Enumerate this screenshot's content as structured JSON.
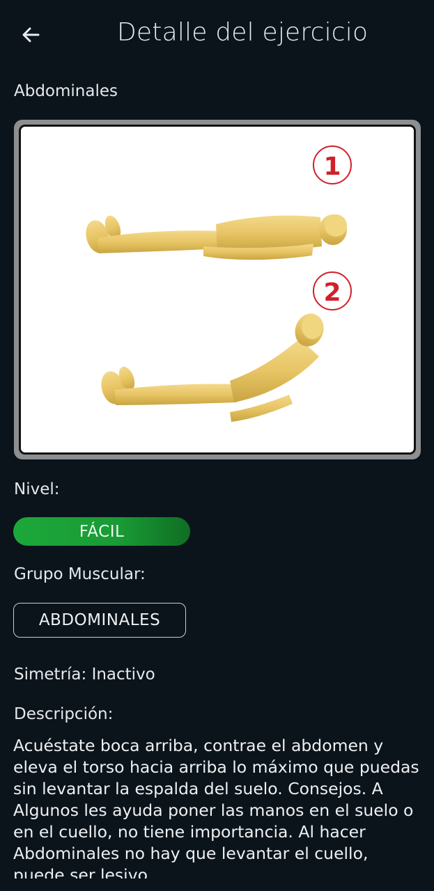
{
  "header": {
    "title": "Detalle del ejercicio",
    "back_icon": "arrow-left-icon"
  },
  "exercise": {
    "name": "Abdominales",
    "image_alt": "Abdominales illustration",
    "step_labels": [
      "1",
      "2"
    ]
  },
  "level": {
    "label": "Nivel:",
    "value": "FÁCIL",
    "color": "#1ca83a"
  },
  "muscle_group": {
    "label": "Grupo Muscular:",
    "value": "ABDOMINALES"
  },
  "symmetry": {
    "text": "Simetría: Inactivo"
  },
  "description": {
    "label": "Descripción:",
    "text": "Acuéstate boca arriba, contrae el abdomen y eleva el torso hacia arriba lo máximo que puedas sin levantar la espalda del suelo. Consejos. A Algunos les ayuda poner las manos en el suelo o en el cuello, no tiene importancia. Al hacer Abdominales no hay que levantar el cuello, puede ser lesivo"
  },
  "colors": {
    "background": "#0b141b",
    "text": "#e6e9ec",
    "step_circle": "#d0202a"
  }
}
